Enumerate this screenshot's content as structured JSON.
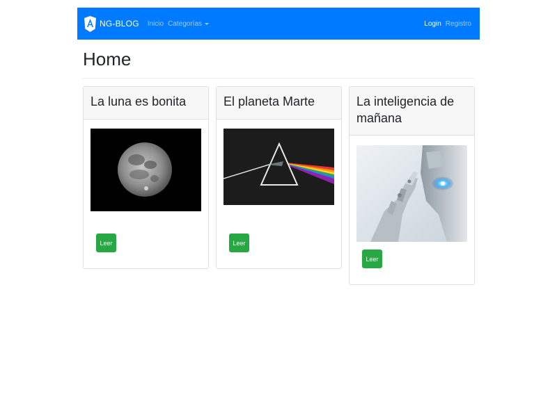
{
  "navbar": {
    "brand": "NG-BLOG",
    "links": {
      "home": "Inicio",
      "categories": "Categorías"
    },
    "right": {
      "login": "Login",
      "register": "Registro"
    },
    "color": "#007bff"
  },
  "page": {
    "title": "Home"
  },
  "posts": [
    {
      "title": "La luna es bonita",
      "image": "moon",
      "button": "Leer"
    },
    {
      "title": "El planeta Marte",
      "image": "prism",
      "button": "Leer"
    },
    {
      "title": "La inteligencia de mañana",
      "image": "robot",
      "button": "Leer"
    }
  ],
  "colors": {
    "button": "#28a745",
    "card_header": "#f7f7f7"
  }
}
